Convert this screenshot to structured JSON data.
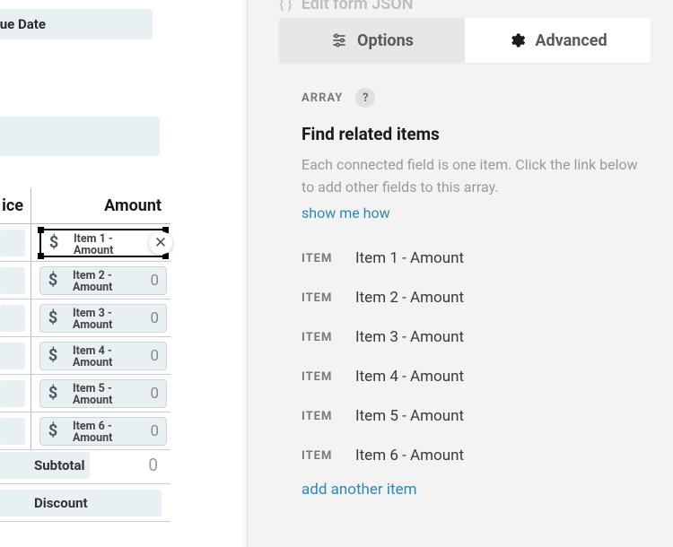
{
  "left": {
    "due_date": "Due Date",
    "col_ice": "ice",
    "col_amount": "Amount",
    "rows": [
      {
        "label_l1": "Item 1 -",
        "label_l2": "Amount",
        "value": ""
      },
      {
        "label_l1": "Item 2 -",
        "label_l2": "Amount",
        "value": "0"
      },
      {
        "label_l1": "Item 3 -",
        "label_l2": "Amount",
        "value": "0"
      },
      {
        "label_l1": "Item 4 -",
        "label_l2": "Amount",
        "value": "0"
      },
      {
        "label_l1": "Item 5 -",
        "label_l2": "Amount",
        "value": "0"
      },
      {
        "label_l1": "Item 6 -",
        "label_l2": "Amount",
        "value": "0"
      }
    ],
    "dollar": "$",
    "subtotal_label": "Subtotal",
    "subtotal_value": "0",
    "discount_label": "Discount"
  },
  "right": {
    "edit_json": "Edit form JSON",
    "tab_options": "Options",
    "tab_advanced": "Advanced",
    "array_label": "ARRAY",
    "help_q": "?",
    "find_title": "Find related items",
    "help_text": "Each connected field is one item. Click the link below to add other fields to this array.",
    "show_link": "show me how",
    "item_tag": "ITEM",
    "items": [
      "Item 1 - Amount",
      "Item 2 - Amount",
      "Item 3 - Amount",
      "Item 4 - Amount",
      "Item 5 - Amount",
      "Item 6 - Amount"
    ],
    "add_another": "add another item"
  }
}
